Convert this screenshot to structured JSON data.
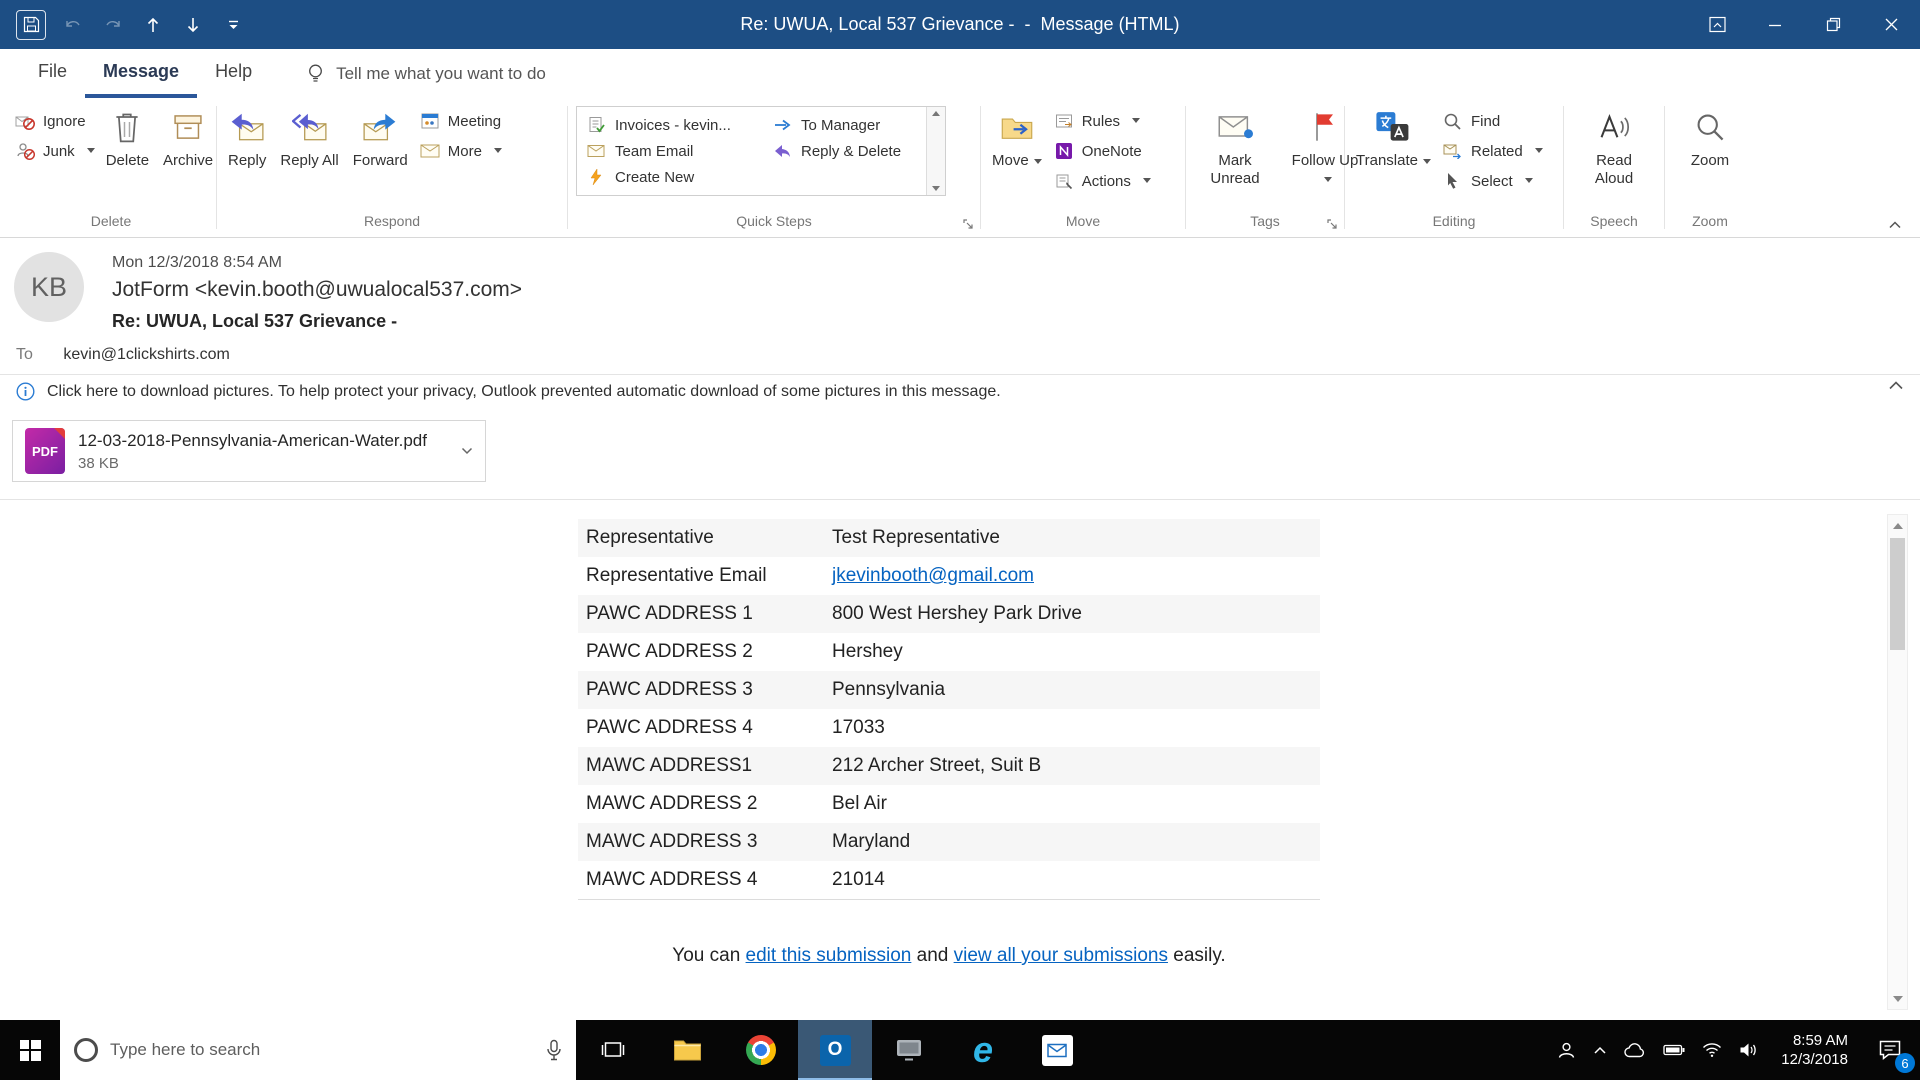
{
  "colors": {
    "titlebar_bg": "#1d4e84",
    "tab_accent": "#2b579a",
    "link_blue": "#0563c1",
    "flag_red": "#e23c31",
    "onenote_purple": "#7719aa",
    "taskbar_bg": "#060606",
    "badge_blue": "#0078d7"
  },
  "titlebar": {
    "title": "Re: UWUA, Local 537 Grievance -  -  Message (HTML)"
  },
  "menubar": {
    "file": "File",
    "message": "Message",
    "help": "Help",
    "tell_me": "Tell me what you want to do"
  },
  "ribbon": {
    "delete_group": {
      "label": "Delete",
      "ignore": "Ignore",
      "junk": "Junk",
      "del": "Delete",
      "archive": "Archive"
    },
    "respond_group": {
      "label": "Respond",
      "reply": "Reply",
      "reply_all": "Reply All",
      "forward": "Forward",
      "meeting": "Meeting",
      "more": "More"
    },
    "quick_steps_group": {
      "label": "Quick Steps",
      "items": [
        {
          "label": "Invoices - kevin..."
        },
        {
          "label": "Team Email"
        },
        {
          "label": "Create New"
        },
        {
          "label": "To Manager"
        },
        {
          "label": "Reply & Delete"
        }
      ]
    },
    "move_group": {
      "label": "Move",
      "move": "Move",
      "rules": "Rules",
      "onenote": "OneNote",
      "actions": "Actions"
    },
    "tags_group": {
      "label": "Tags",
      "mark_unread": "Mark Unread",
      "follow_up": "Follow Up"
    },
    "editing_group": {
      "label": "Editing",
      "translate": "Translate",
      "find": "Find",
      "related": "Related",
      "select": "Select"
    },
    "speech_group": {
      "label": "Speech",
      "read_aloud": "Read Aloud"
    },
    "zoom_group": {
      "label": "Zoom",
      "zoom": "Zoom"
    }
  },
  "email": {
    "initials": "KB",
    "date": "Mon 12/3/2018 8:54 AM",
    "from": "JotForm <kevin.booth@uwualocal537.com>",
    "subject": "Re: UWUA, Local 537 Grievance -",
    "to_label": "To",
    "to": "kevin@1clickshirts.com",
    "infobar": "Click here to download pictures. To help protect your privacy, Outlook prevented automatic download of some pictures in this message.",
    "attachment": {
      "pdf_label": "PDF",
      "name": "12-03-2018-Pennsylvania-American-Water.pdf",
      "size": "38 KB"
    }
  },
  "body": {
    "table": {
      "rows": [
        {
          "label": "Representative",
          "value": "Test Representative"
        },
        {
          "label": "Representative Email",
          "value": "jkevinbooth@gmail.com"
        },
        {
          "label": "PAWC ADDRESS 1",
          "value": "800 West Hershey Park Drive"
        },
        {
          "label": "PAWC ADDRESS 2",
          "value": "Hershey"
        },
        {
          "label": "PAWC ADDRESS 3",
          "value": "Pennsylvania"
        },
        {
          "label": "PAWC ADDRESS 4",
          "value": "17033"
        },
        {
          "label": "MAWC ADDRESS1",
          "value": "212 Archer Street, Suit B"
        },
        {
          "label": "MAWC ADDRESS 2",
          "value": "Bel Air"
        },
        {
          "label": "MAWC ADDRESS 3",
          "value": "Maryland"
        },
        {
          "label": "MAWC ADDRESS 4",
          "value": "21014"
        }
      ]
    },
    "footer": {
      "pre": "You can ",
      "link1": "edit this submission",
      "mid": " and ",
      "link2": "view all your submissions",
      "post": " easily."
    }
  },
  "taskbar": {
    "search_placeholder": "Type here to search",
    "outlook_letter": "O",
    "ie_letter": "e",
    "clock_time": "8:59 AM",
    "clock_date": "12/3/2018",
    "badge": "6"
  }
}
